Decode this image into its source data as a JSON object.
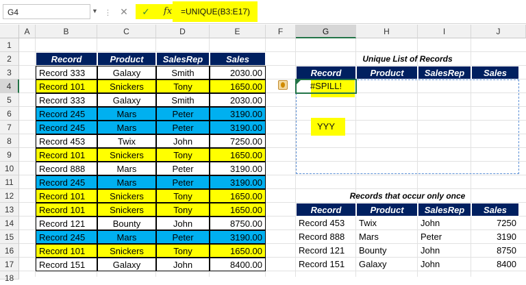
{
  "formula_bar": {
    "name_box": "G4",
    "formula": "=UNIQUE(B3:E17)",
    "cancel_icon": "close-icon",
    "enter_icon": "check-icon",
    "function_icon": "fx-icon",
    "fx_label": "fx",
    "cancel_glyph": "✕",
    "enter_glyph": "✓"
  },
  "columns": [
    "A",
    "B",
    "C",
    "D",
    "E",
    "F",
    "G",
    "H",
    "I",
    "J"
  ],
  "rows": [
    "1",
    "2",
    "3",
    "4",
    "5",
    "6",
    "7",
    "8",
    "9",
    "10",
    "11",
    "12",
    "13",
    "14",
    "15",
    "16",
    "17",
    "18"
  ],
  "active_cell": {
    "column": "G",
    "row": "4"
  },
  "colors": {
    "header_navy": "#002060",
    "yellow": "#ffff00",
    "blue": "#00b0f0",
    "excel_green": "#217346"
  },
  "main_table": {
    "headers": [
      "Record",
      "Product",
      "SalesRep",
      "Sales"
    ],
    "rows": [
      {
        "record": "Record 333",
        "product": "Galaxy",
        "salesrep": "Smith",
        "sales": "2030.00",
        "fill": "white"
      },
      {
        "record": "Record 101",
        "product": "Snickers",
        "salesrep": "Tony",
        "sales": "1650.00",
        "fill": "yellow"
      },
      {
        "record": "Record 333",
        "product": "Galaxy",
        "salesrep": "Smith",
        "sales": "2030.00",
        "fill": "white"
      },
      {
        "record": "Record 245",
        "product": "Mars",
        "salesrep": "Peter",
        "sales": "3190.00",
        "fill": "blue"
      },
      {
        "record": "Record 245",
        "product": "Mars",
        "salesrep": "Peter",
        "sales": "3190.00",
        "fill": "blue"
      },
      {
        "record": "Record 453",
        "product": "Twix",
        "salesrep": "John",
        "sales": "7250.00",
        "fill": "white"
      },
      {
        "record": "Record 101",
        "product": "Snickers",
        "salesrep": "Tony",
        "sales": "1650.00",
        "fill": "yellow"
      },
      {
        "record": "Record 888",
        "product": "Mars",
        "salesrep": "Peter",
        "sales": "3190.00",
        "fill": "white"
      },
      {
        "record": "Record 245",
        "product": "Mars",
        "salesrep": "Peter",
        "sales": "3190.00",
        "fill": "blue"
      },
      {
        "record": "Record 101",
        "product": "Snickers",
        "salesrep": "Tony",
        "sales": "1650.00",
        "fill": "yellow"
      },
      {
        "record": "Record 101",
        "product": "Snickers",
        "salesrep": "Tony",
        "sales": "1650.00",
        "fill": "yellow"
      },
      {
        "record": "Record 121",
        "product": "Bounty",
        "salesrep": "John",
        "sales": "8750.00",
        "fill": "white"
      },
      {
        "record": "Record 245",
        "product": "Mars",
        "salesrep": "Peter",
        "sales": "3190.00",
        "fill": "blue"
      },
      {
        "record": "Record 101",
        "product": "Snickers",
        "salesrep": "Tony",
        "sales": "1650.00",
        "fill": "yellow"
      },
      {
        "record": "Record 151",
        "product": "Galaxy",
        "salesrep": "John",
        "sales": "8400.00",
        "fill": "white"
      }
    ]
  },
  "unique_table": {
    "title": "Unique List of Records",
    "headers": [
      "Record",
      "Product",
      "SalesRep",
      "Sales"
    ],
    "spill_value": "#SPILL!",
    "blocker_value": "YYY",
    "warning_icon": "warning-icon"
  },
  "once_table": {
    "title": "Records that occur only once",
    "headers": [
      "Record",
      "Product",
      "SalesRep",
      "Sales"
    ],
    "rows": [
      {
        "record": "Record 453",
        "product": "Twix",
        "salesrep": "John",
        "sales": "7250"
      },
      {
        "record": "Record 888",
        "product": "Mars",
        "salesrep": "Peter",
        "sales": "3190"
      },
      {
        "record": "Record 121",
        "product": "Bounty",
        "salesrep": "John",
        "sales": "8750"
      },
      {
        "record": "Record 151",
        "product": "Galaxy",
        "salesrep": "John",
        "sales": "8400"
      }
    ]
  }
}
